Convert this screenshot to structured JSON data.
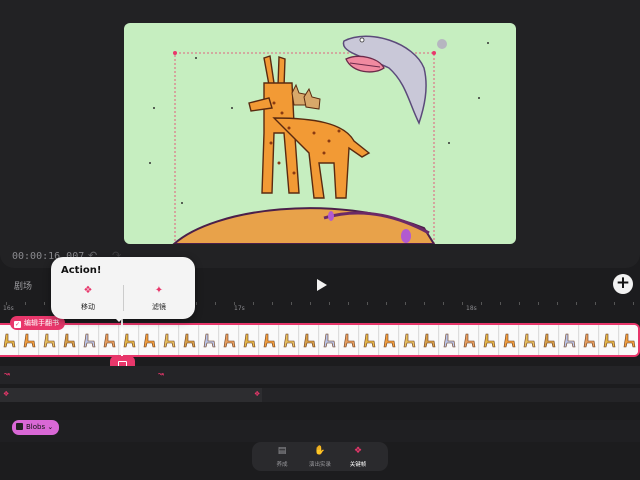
{
  "preview": {
    "timecode": "00:00:16.007",
    "undo_icon": "undo-icon",
    "redo_icon": "redo-icon"
  },
  "transport": {
    "scene_label": "剧场",
    "play_icon": "play-icon",
    "add_icon": "plus-icon",
    "add_label": "+"
  },
  "ruler": {
    "labels": [
      "16s",
      "17s",
      "18s"
    ]
  },
  "strip": {
    "tag_label": "编辑手翻书",
    "frame_count": 32
  },
  "action_popover": {
    "title": "Action!",
    "move_label": "移动",
    "move_icon": "keyframe-diamond-icon",
    "filter_label": "滤镜",
    "filter_icon": "sparkle-icon"
  },
  "tracks": {
    "keyframe_icon": "keyframe-icon",
    "blobs_label": "Blobs"
  },
  "bottom_bar": {
    "items": [
      {
        "label": "养成",
        "icon": "layers-icon"
      },
      {
        "label": "演出实录",
        "icon": "hand-icon"
      },
      {
        "label": "关键帧",
        "icon": "keyframe-diamond-icon"
      }
    ],
    "active_index": 2
  },
  "colors": {
    "accent": "#e8376b",
    "canvas_bg": "#c6eec0",
    "chip_purple": "#d968d6"
  }
}
